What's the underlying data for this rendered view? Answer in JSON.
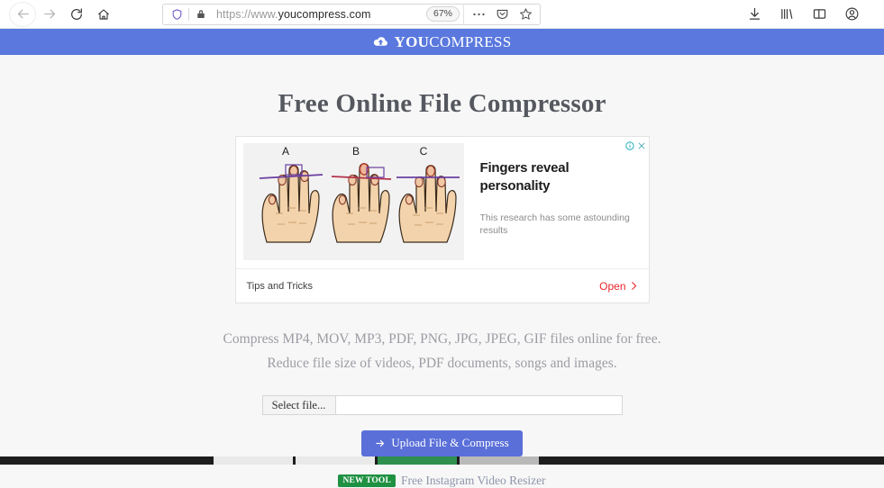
{
  "browser": {
    "nav": {
      "back_label": "Back",
      "forward_label": "Forward",
      "reload_label": "Reload",
      "home_label": "Home"
    },
    "urlbar": {
      "shield_label": "Tracking protection",
      "lock_label": "Connection secure",
      "url_scheme": "https://www.",
      "url_domain": "youcompress.com",
      "zoom_level": "67%",
      "menu_label": "Page actions",
      "pocket_label": "Save to Pocket",
      "bookmark_label": "Bookmark this page"
    },
    "toolbar_right": {
      "downloads_label": "Downloads",
      "library_label": "Library",
      "sidebar_label": "Sidebar",
      "account_label": "Account"
    }
  },
  "site": {
    "logo": {
      "icon": "cloud-upload-icon",
      "part_bold": "YOU",
      "part_light": "COMPRESS"
    },
    "header_color": "#5a78dd"
  },
  "main": {
    "title": "Free Online File Compressor",
    "description_line1": "Compress MP4, MOV, MP3, PDF, PNG, JPG, JPEG, GIF files online for free.",
    "description_line2": "Reduce file size of videos, PDF documents, songs and images.",
    "file_picker": {
      "button_label": "Select file...",
      "field_value": "",
      "field_placeholder": ""
    },
    "upload_button": {
      "icon": "arrow-right-icon",
      "label": "Upload File & Compress",
      "color": "#5a6fd8"
    },
    "new_tool": {
      "badge": "NEW TOOL",
      "badge_color": "#1f9142",
      "link_label": "Free Instagram Video Resizer"
    }
  },
  "ad": {
    "info_icon": "adchoices-info-icon",
    "close_icon": "close-icon",
    "image_labels": [
      "A",
      "B",
      "C"
    ],
    "image_alt": "three-hands-diagram",
    "headline": "Fingers reveal personality",
    "subtext": "This research has some astounding results",
    "advertiser": "Tips and Tricks",
    "cta_label": "Open",
    "cta_color": "#e8262a"
  }
}
